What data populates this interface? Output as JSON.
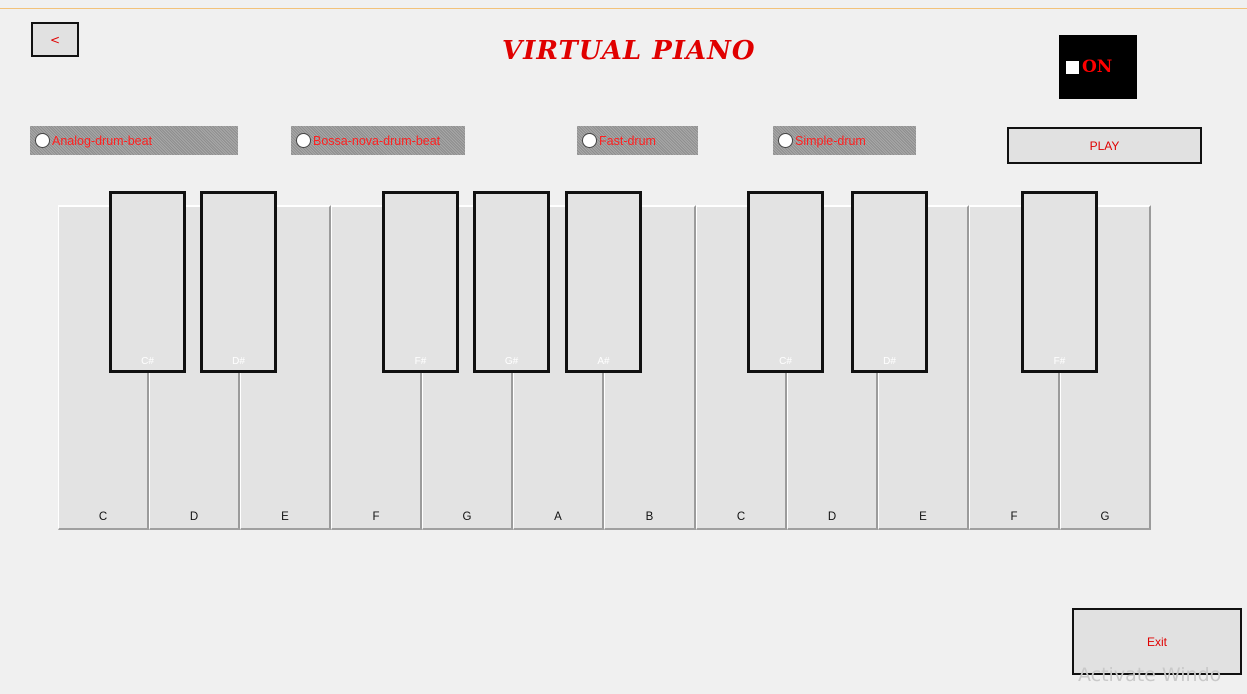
{
  "app": {
    "title": "VIRTUAL PIANO"
  },
  "nav": {
    "back_label": "<"
  },
  "power": {
    "label": "ON",
    "checked": false
  },
  "beats": [
    {
      "label": "Analog-drum-beat",
      "selected": false
    },
    {
      "label": "Bossa-nova-drum-beat",
      "selected": false
    },
    {
      "label": "Fast-drum",
      "selected": false
    },
    {
      "label": "Simple-drum",
      "selected": false
    }
  ],
  "play_label": "PLAY",
  "keyboard": {
    "white_keys": [
      "C",
      "D",
      "E",
      "F",
      "G",
      "A",
      "B",
      "C",
      "D",
      "E",
      "F",
      "G"
    ],
    "black_keys": [
      "C#",
      "D#",
      "F#",
      "G#",
      "A#",
      "C#",
      "D#",
      "F#"
    ]
  },
  "exit_label": "Exit",
  "watermark": "Activate Windo",
  "colors": {
    "accent": "#e00000",
    "background": "#f0f0f0",
    "key": "#e3e3e3"
  }
}
